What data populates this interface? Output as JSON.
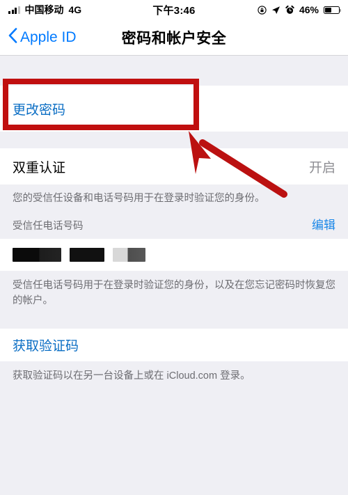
{
  "status_bar": {
    "carrier": "中国移动",
    "network": "4G",
    "time": "下午3:46",
    "battery_percent": "46%",
    "battery_level": 46,
    "icons": [
      "signal-bars-icon",
      "rotation-lock-icon",
      "location-arrow-icon",
      "alarm-clock-icon",
      "battery-icon"
    ]
  },
  "navbar": {
    "back_label": "Apple ID",
    "title": "密码和帐户安全"
  },
  "sections": {
    "change_password": {
      "label": "更改密码"
    },
    "two_factor": {
      "label": "双重认证",
      "value": "开启",
      "footer": "您的受信任设备和电话号码用于在登录时验证您的身份。"
    },
    "trusted_numbers": {
      "header": "受信任电话号码",
      "edit_label": "编辑",
      "redacted_items": [
        "redacted-phone-1",
        "redacted-phone-2",
        "redacted-phone-3"
      ],
      "footer": "受信任电话号码用于在登录时验证您的身份，以及在您忘记密码时恢复您的帐户。"
    },
    "verification_code": {
      "label": "获取验证码",
      "footer": "获取验证码以在另一台设备上或在 iCloud.com 登录。"
    }
  },
  "annotation": {
    "highlight_target": "更改密码",
    "color": "#c00f0f",
    "shapes": [
      "red-rectangle-highlight",
      "red-arrow-pointer"
    ]
  },
  "colors": {
    "ios_blue": "#007aff",
    "link_blue": "#0b6ec4",
    "gray_text": "#6d6d72",
    "value_gray": "#8e8e93",
    "page_bg": "#efeff4",
    "annotation_red": "#c00f0f"
  }
}
